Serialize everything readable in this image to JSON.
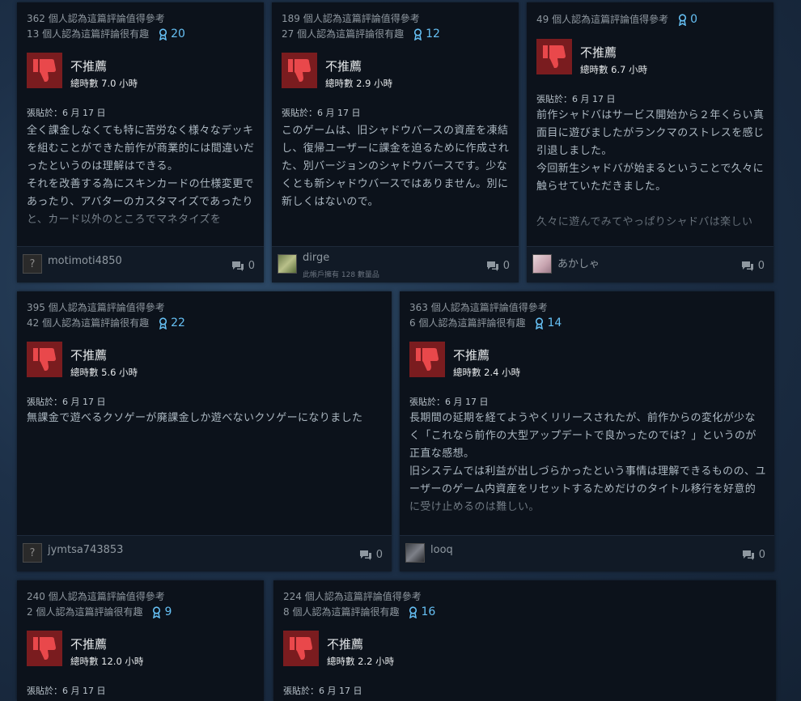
{
  "labels": {
    "verdict": "不推薦",
    "posted": "張貼於：6 月 17 日"
  },
  "reviews": [
    {
      "helpful": "362 個人認為這篇評論值得參考",
      "funny": "13 個人認為這篇評論很有趣",
      "awards": "20",
      "hours": "總時數 7.0 小時",
      "content": "全く課金しなくても特に苦労なく様々なデッキを組むことができた前作が商業的には間違いだったというのは理解はできる。\nそれを改善する為にスキンカードの仕様変更であったり、アバターのカスタマイズであったりと、カード以外のところでマネタイズを",
      "author": "motimoti4850",
      "owned": "",
      "comments": "0"
    },
    {
      "helpful": "189 個人認為這篇評論值得參考",
      "funny": "27 個人認為這篇評論很有趣",
      "awards": "12",
      "hours": "總時數 2.9 小時",
      "content": "このゲームは、旧シャドウバースの資産を凍結し、復帰ユーザーに課金を迫るために作成された、別バージョンのシャドウバースです。少なくとも新シャドウバースではありません。別に新しくはないので。",
      "author": "dirge",
      "owned": "此帳戶擁有 128 數量品",
      "comments": "0"
    },
    {
      "helpful": "49 個人認為這篇評論值得參考",
      "funny": "",
      "awards": "0",
      "hours": "總時數 6.7 小時",
      "content": "前作シャドバはサービス開始から２年くらい真面目に遊びましたがランクマのストレスを感じ引退しました。\n今回新生シャドバが始まるということで久々に触らせていただきました。\n\n久々に遊んでみてやっぱりシャドバは楽しい",
      "author": "あかしゃ",
      "owned": "",
      "comments": "0"
    },
    {
      "helpful": "395 個人認為這篇評論值得參考",
      "funny": "42 個人認為這篇評論很有趣",
      "awards": "22",
      "hours": "總時數 5.6 小時",
      "content": "無課金で遊べるクソゲーが廃課金しか遊べないクソゲーになりました",
      "author": "jymtsa743853",
      "owned": "",
      "comments": "0"
    },
    {
      "helpful": "363 個人認為這篇評論值得參考",
      "funny": "6 個人認為這篇評論很有趣",
      "awards": "14",
      "hours": "總時數 2.4 小時",
      "content": "長期間の延期を経てようやくリリースされたが、前作からの変化が少なく「これなら前作の大型アップデートで良かったのでは？」というのが正直な感想。\n旧システムでは利益が出しづらかったという事情は理解できるものの、ユーザーのゲーム内資産をリセットするためだけのタイトル移行を好意的に受け止めるのは難しい。",
      "author": "looq",
      "owned": "",
      "comments": "0"
    },
    {
      "helpful": "240 個人認為這篇評論值得參考",
      "funny": "2 個人認為這篇評論很有趣",
      "awards": "9",
      "hours": "總時數 12.0 小時",
      "content": "",
      "author": "",
      "owned": "",
      "comments": ""
    },
    {
      "helpful": "224 個人認為這篇評論值得參考",
      "funny": "8 個人認為這篇評論很有趣",
      "awards": "16",
      "hours": "總時數 2.2 小時",
      "content": "",
      "author": "",
      "owned": "",
      "comments": ""
    }
  ]
}
